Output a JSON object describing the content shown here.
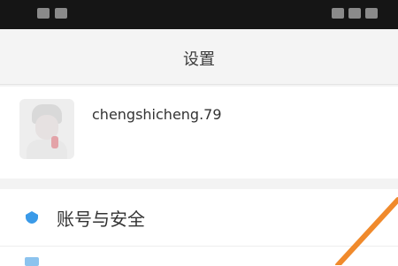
{
  "status_bar": {
    "left_text": "",
    "time": ""
  },
  "nav": {
    "title": "设置"
  },
  "profile": {
    "username": "chengshicheng.79",
    "account_id": "",
    "avatar_icon": "avatar-icon"
  },
  "menu": {
    "items": [
      {
        "label": "账号与安全",
        "icon": "shield-icon",
        "color": "#3a9ae8"
      }
    ]
  },
  "colors": {
    "accent_line": "#f08a2c",
    "status_bar_bg": "#151515"
  }
}
